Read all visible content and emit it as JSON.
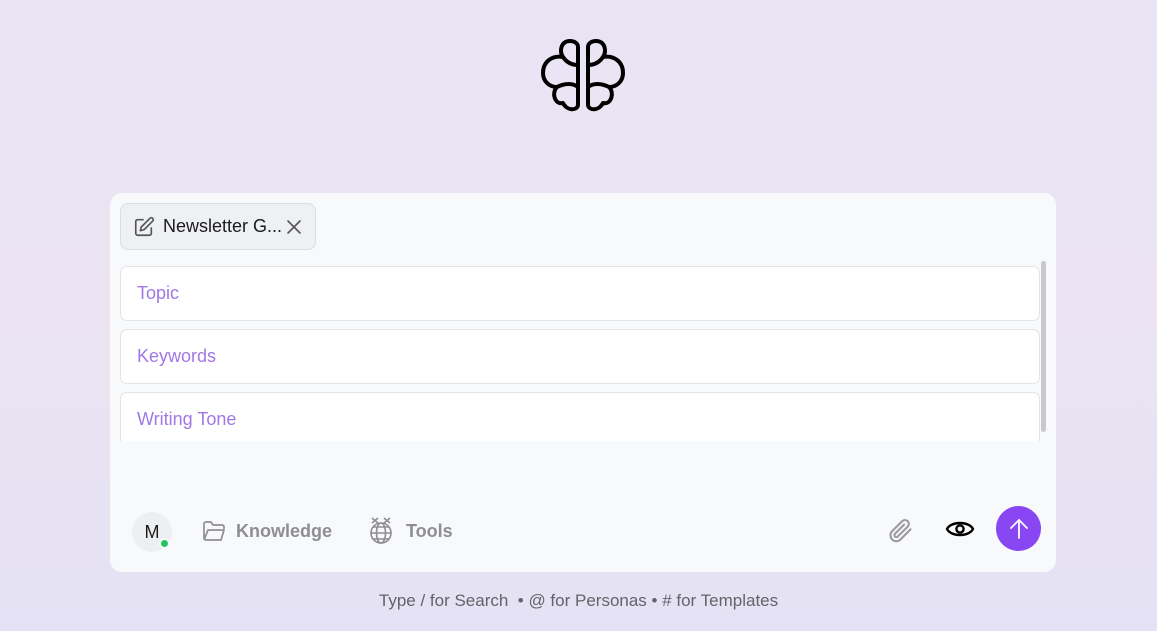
{
  "template_chip": {
    "label": "Newsletter G...",
    "icon": "edit-icon"
  },
  "fields": [
    {
      "placeholder": "Topic"
    },
    {
      "placeholder": "Keywords"
    },
    {
      "placeholder": "Writing Tone"
    }
  ],
  "toolbar": {
    "avatar_initial": "M",
    "knowledge_label": "Knowledge",
    "tools_label": "Tools"
  },
  "footer_hint": "Type / for Search  • @ for Personas • # for Templates",
  "colors": {
    "accent": "#8847f2",
    "placeholder": "#a178e4",
    "status_online": "#22c55e"
  }
}
